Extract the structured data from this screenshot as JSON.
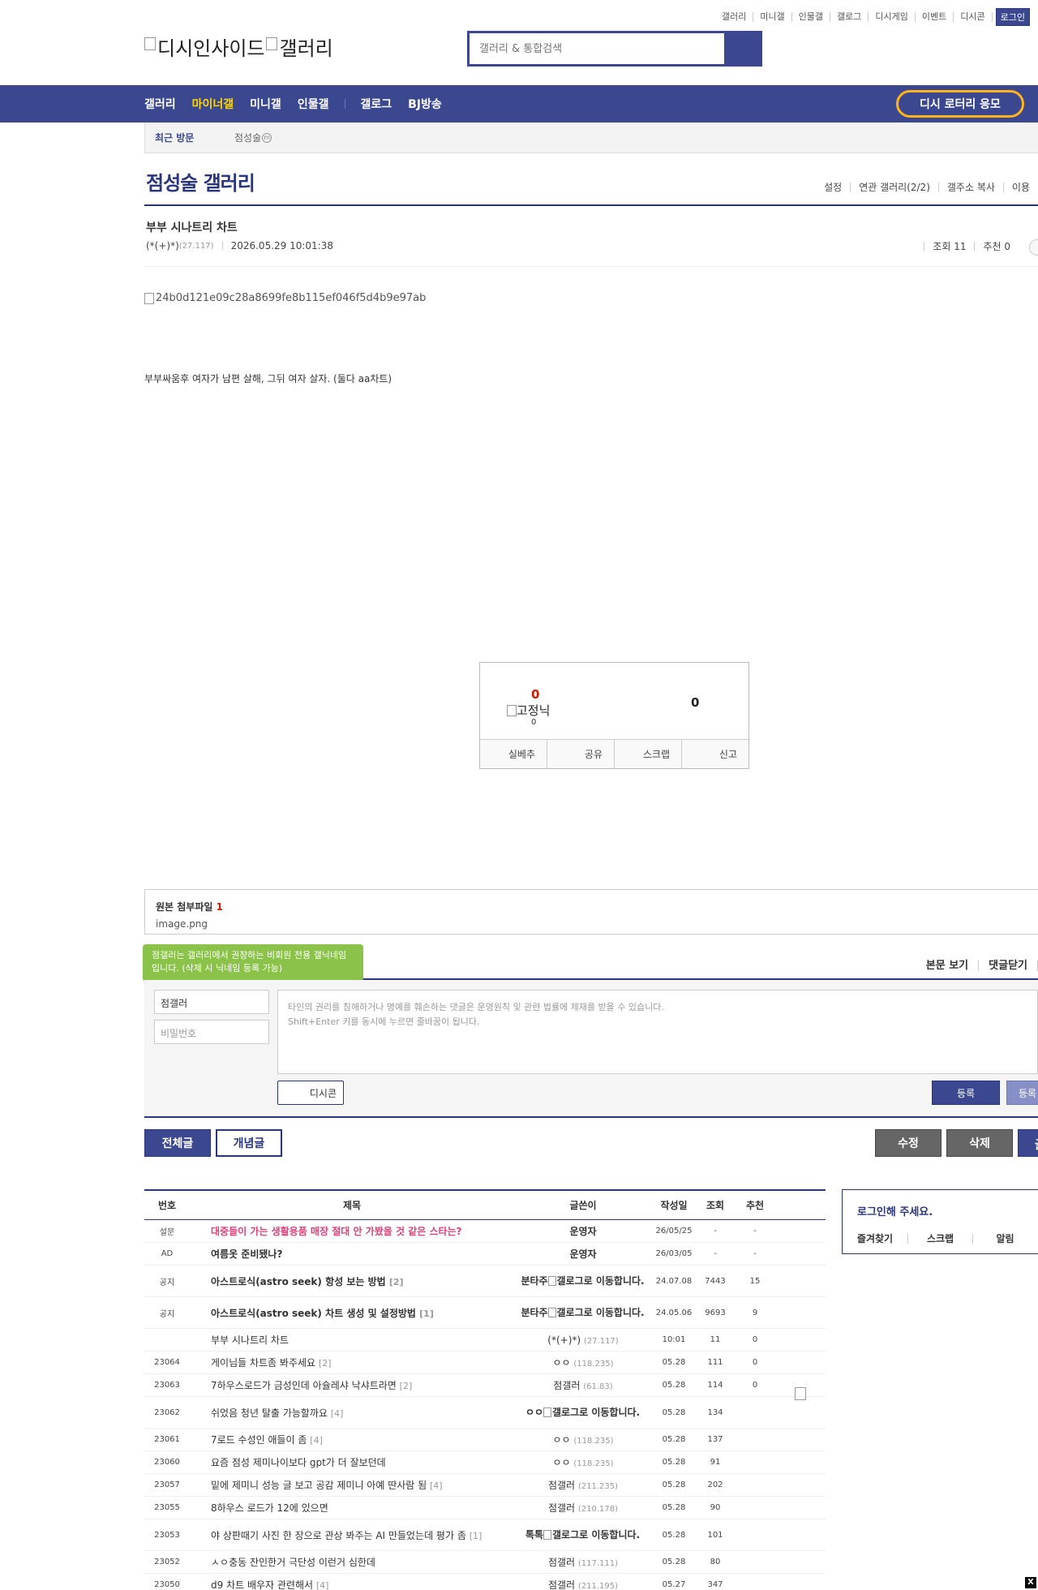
{
  "top_util": [
    "갤러리",
    "미니갤",
    "인물갤",
    "갤로그",
    "디시게임",
    "이벤트",
    "디시콘"
  ],
  "login_label": "로그인",
  "logo": {
    "text_left": "디시인사이드",
    "text_right": "갤러리"
  },
  "search": {
    "placeholder": "갤러리 & 통합검색"
  },
  "gnb": {
    "items": [
      "갤러리",
      "마이너갤",
      "미니갤",
      "인물갤"
    ],
    "items2": [
      "갤로그",
      "BJ방송"
    ],
    "lotto": "디시 로터리 응모"
  },
  "recent": {
    "title": "최근 방문",
    "gallery": "점성술",
    "badge": "m"
  },
  "gallery": {
    "title": "점성술 갤러리",
    "links": [
      "설정",
      "연관 갤러리(2/2)",
      "갤주소 복사",
      "이용"
    ]
  },
  "post": {
    "title": "부부 시나트리 차트",
    "writer": "(*(+)*)",
    "ip": "(27.117)",
    "datetime": "2026.05.29 10:01:38",
    "views": "조회 11",
    "recommend": "추천 0",
    "image_alt": "24b0d121e09c28a8699fe8b115ef046f5d4b9e97ab",
    "body": "부부싸움후 여자가 남편 살해,  그뒤 여자 살자. (둘다 aa차트)"
  },
  "rec_box": {
    "up_count": "0",
    "fixnick_label": "고정닉",
    "fixnick_count": "0",
    "down_count": "0",
    "actions": [
      "실베추",
      "공유",
      "스크랩",
      "신고"
    ]
  },
  "attach": {
    "title": "원본 첨부파일",
    "count": "1",
    "file": "image.png"
  },
  "comments": {
    "title_cut": "",
    "links": [
      "본문 보기",
      "댓글닫기"
    ],
    "tooltip": "점갤러는 갤러리에서 권장하는 비회원 전용 갤닉네임입니다. (삭제 시 닉네임 등록 가능)",
    "nick_value": "점갤러",
    "pw_placeholder": "비밀번호",
    "text_placeholder_1": "타인의 권리를 침해하거나 명예를 훼손하는 댓글은 운영원칙 및 관련 법률에 제재를 받을 수 있습니다.",
    "text_placeholder_2": "Shift+Enter 키를 동시에 누르면 줄바꿈이 됩니다.",
    "dccon": "디시콘",
    "submit": "등록",
    "submit2": "등록"
  },
  "buttons": {
    "all": "전체글",
    "concept": "개념글",
    "edit": "수정",
    "delete": "삭제",
    "write": "글"
  },
  "list": {
    "headers": [
      "번호",
      "제목",
      "글쓴이",
      "작성일",
      "조회",
      "추천"
    ],
    "rows": [
      {
        "no": "설문",
        "subject": "대중들이 가는 생활용품 매장 절대 안 가봤을 것 같은 스타는?",
        "reply": "",
        "writer": "운영자",
        "ip": "",
        "date": "26/05/25",
        "views": "-",
        "rec": "-"
      },
      {
        "no": "AD",
        "subject": "여름옷 준비됐나?",
        "reply": "",
        "writer": "운영자",
        "ip": "",
        "date": "26/03/05",
        "views": "-",
        "rec": "-"
      },
      {
        "no": "공지",
        "subject": "아스트로식(astro seek) 항성 보는 방법",
        "reply": "[2]",
        "writer": "분타주",
        "writer_img": "갤로그로 이동합니다.",
        "date": "24.07.08",
        "views": "7443",
        "rec": "15"
      },
      {
        "no": "공지",
        "subject": "아스트로식(astro seek) 차트 생성 및 설정방법",
        "reply": "[1]",
        "writer": "분타주",
        "writer_img": "갤로그로 이동합니다.",
        "date": "24.05.06",
        "views": "9693",
        "rec": "9"
      },
      {
        "no": "",
        "subject": "부부 시나트리 차트",
        "reply": "",
        "writer": "(*(+)*)",
        "ip": "(27.117)",
        "date": "10:01",
        "views": "11",
        "rec": "0"
      },
      {
        "no": "23064",
        "subject": "게이님들 차트좀 봐주세요",
        "reply": "[2]",
        "writer": "ㅇㅇ",
        "ip": "(118.235)",
        "date": "05.28",
        "views": "111",
        "rec": "0"
      },
      {
        "no": "23063",
        "subject": "7하우스로드가 금성인데 아슐레샤 낙샤트라면",
        "reply": "[2]",
        "writer": "점갤러",
        "ip": "(61.83)",
        "date": "05.28",
        "views": "114",
        "rec": "0"
      },
      {
        "no": "23062",
        "subject": "쉬었음 청년 탈출 가능할까요",
        "reply": "[4]",
        "writer": "ㅇㅇ",
        "writer_img": "갤로그로 이동합니다.",
        "date": "05.28",
        "views": "134",
        "rec": ""
      },
      {
        "no": "23061",
        "subject": "7로드 수성인 애들이 좀",
        "reply": "[4]",
        "writer": "ㅇㅇ",
        "ip": "(118.235)",
        "date": "05.28",
        "views": "137",
        "rec": ""
      },
      {
        "no": "23060",
        "subject": "요즘 점성 제미나이보다 gpt가 더 잘보던데",
        "reply": "",
        "writer": "ㅇㅇ",
        "ip": "(118.235)",
        "date": "05.28",
        "views": "91",
        "rec": ""
      },
      {
        "no": "23057",
        "subject": "밑에 제미니 성능 글 보고 공감 제미니 아예 딴사람 됨",
        "reply": "[4]",
        "writer": "점갤러",
        "ip": "(211.235)",
        "date": "05.28",
        "views": "202",
        "rec": ""
      },
      {
        "no": "23055",
        "subject": "8하우스 로드가 12에 있으면",
        "reply": "",
        "writer": "점갤러",
        "ip": "(210.178)",
        "date": "05.28",
        "views": "90",
        "rec": ""
      },
      {
        "no": "23053",
        "subject": "야 상판때기 사진 한 장으로 관상 봐주는 AI 만들었는데 평가 좀",
        "reply": "[1]",
        "writer": "톡톡",
        "writer_img": "갤로그로 이동합니다.",
        "date": "05.28",
        "views": "101",
        "rec": ""
      },
      {
        "no": "23052",
        "subject": "ㅅㅇ충동 잔인한거 극단성 이런거 심한데",
        "reply": "",
        "writer": "점갤러",
        "ip": "(117.111)",
        "date": "05.28",
        "views": "80",
        "rec": ""
      },
      {
        "no": "23050",
        "subject": "d9 차트 배우자 관련해서",
        "reply": "[4]",
        "writer": "점갤러",
        "ip": "(211.195)",
        "date": "05.27",
        "views": "347",
        "rec": ""
      }
    ]
  },
  "side": {
    "title": "로그인해 주세요.",
    "links": [
      "즐겨찾기",
      "스크랩",
      "알림"
    ]
  },
  "close": "X"
}
